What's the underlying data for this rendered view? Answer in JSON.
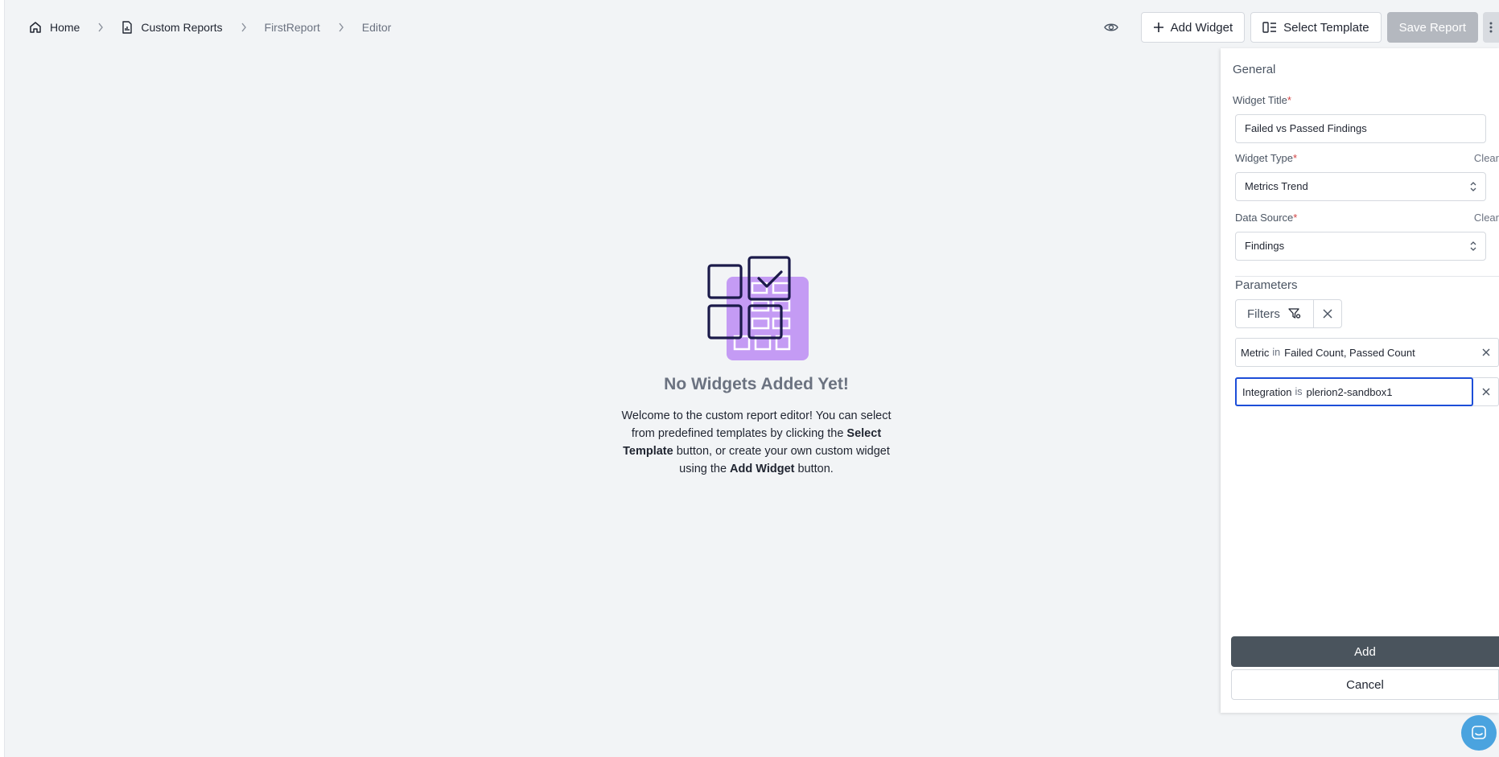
{
  "breadcrumb": {
    "home": "Home",
    "custom_reports": "Custom Reports",
    "report": "FirstReport",
    "editor": "Editor"
  },
  "toolbar": {
    "preview_icon": "eye-icon",
    "add_widget": "Add Widget",
    "select_template": "Select Template",
    "save_report": "Save Report",
    "more_icon": "more-vertical-icon"
  },
  "empty_state": {
    "title": "No Widgets Added Yet!",
    "desc_1": "Welcome to the custom report editor! You can select from predefined templates by clicking the ",
    "desc_bold_1": "Select Template",
    "desc_2": " button, or create your own custom widget using the ",
    "desc_bold_2": "Add Widget",
    "desc_3": " button."
  },
  "panel": {
    "section_title": "General",
    "widget_title_label": "Widget Title",
    "widget_title_value": "Failed vs Passed Findings",
    "widget_type_label": "Widget Type",
    "widget_type_value": "Metrics Trend",
    "data_source_label": "Data Source",
    "data_source_value": "Findings",
    "clear": "Clear",
    "required_mark": "*",
    "parameters_title": "Parameters",
    "filters_label": "Filters",
    "filter_rows": [
      {
        "key": "Metric",
        "op": "in",
        "value": "Failed Count,  Passed Count"
      },
      {
        "key": "Integration",
        "op": "is",
        "value": "plerion2-sandbox1"
      }
    ],
    "add_label": "Add",
    "cancel_label": "Cancel"
  },
  "colors": {
    "accent_purple": "#c49bf4",
    "navy": "#1b1a4a",
    "primary_dark": "#4a545d",
    "focus_blue": "#1d4ed8"
  }
}
